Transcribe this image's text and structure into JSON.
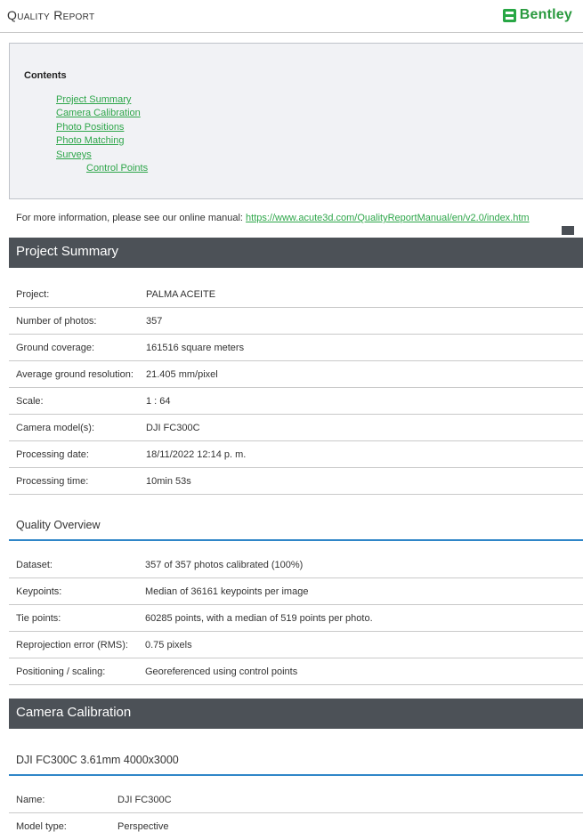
{
  "header": {
    "title": "Quality Report",
    "logo_text": "Bentley"
  },
  "contents": {
    "title": "Contents",
    "links": [
      "Project Summary",
      "Camera Calibration",
      "Photo Positions",
      "Photo Matching",
      "Surveys",
      "Control Points"
    ]
  },
  "info": {
    "text": "For more information, please see our online manual: ",
    "link": "https://www.acute3d.com/QualityReportManual/en/v2.0/index.htm"
  },
  "project_summary": {
    "title": "Project Summary",
    "rows": [
      {
        "label": "Project:",
        "value": "PALMA ACEITE"
      },
      {
        "label": "Number of photos:",
        "value": "357"
      },
      {
        "label": "Ground coverage:",
        "value": "161516 square meters"
      },
      {
        "label": "Average ground resolution:",
        "value": "21.405 mm/pixel"
      },
      {
        "label": "Scale:",
        "value": "1 : 64"
      },
      {
        "label": "Camera model(s):",
        "value": "DJI FC300C"
      },
      {
        "label": "Processing date:",
        "value": "18/11/2022 12:14 p. m."
      },
      {
        "label": "Processing time:",
        "value": "10min 53s"
      }
    ]
  },
  "quality_overview": {
    "title": "Quality Overview",
    "rows": [
      {
        "label": "Dataset:",
        "value": "357 of 357 photos calibrated (100%)"
      },
      {
        "label": "Keypoints:",
        "value": "Median of 36161 keypoints per image"
      },
      {
        "label": "Tie points:",
        "value": "60285 points, with a median of 519 points per photo."
      },
      {
        "label": "Reprojection error (RMS):",
        "value": "0.75 pixels"
      },
      {
        "label": "Positioning / scaling:",
        "value": "Georeferenced using control points"
      }
    ]
  },
  "camera_calibration": {
    "title": "Camera Calibration",
    "camera_title": "DJI FC300C 3.61mm 4000x3000",
    "rows": [
      {
        "label": "Name:",
        "value": "DJI FC300C"
      },
      {
        "label": "Model type:",
        "value": "Perspective"
      }
    ]
  }
}
